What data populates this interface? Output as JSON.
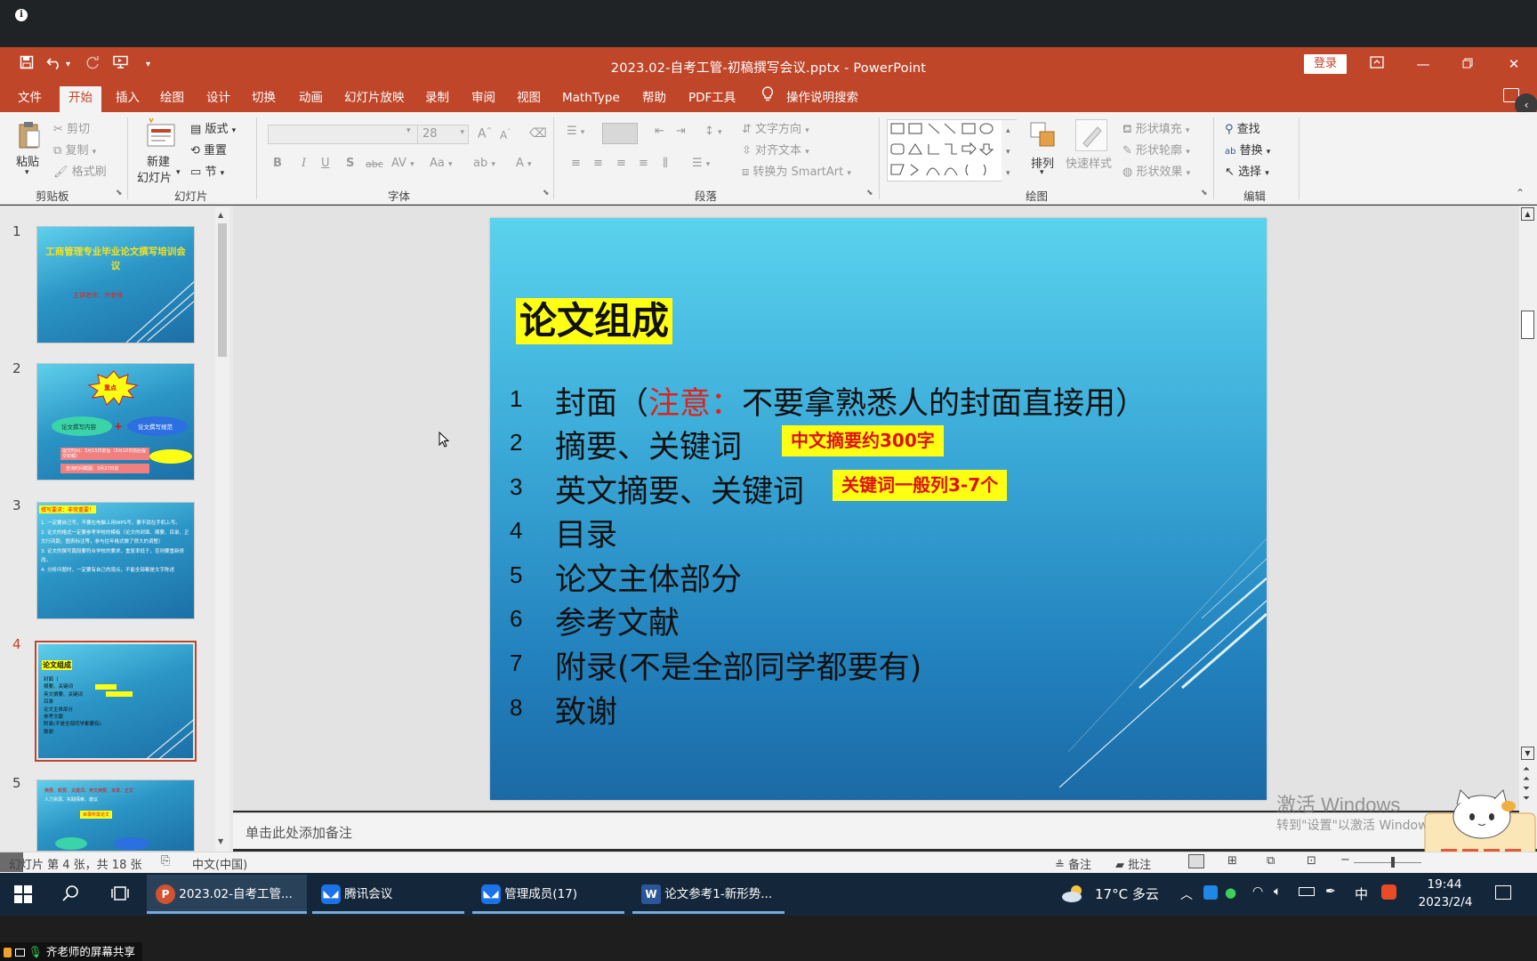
{
  "title_bar": {
    "document_title": "2023.02-自考工管-初稿撰写会议.pptx  -  PowerPoint",
    "login_label": "登录"
  },
  "ribbon_tabs": [
    {
      "label": "文件"
    },
    {
      "label": "开始",
      "active": true
    },
    {
      "label": "插入"
    },
    {
      "label": "绘图"
    },
    {
      "label": "设计"
    },
    {
      "label": "切换"
    },
    {
      "label": "动画"
    },
    {
      "label": "幻灯片放映"
    },
    {
      "label": "录制"
    },
    {
      "label": "审阅"
    },
    {
      "label": "视图"
    },
    {
      "label": "MathType"
    },
    {
      "label": "帮助"
    },
    {
      "label": "PDF工具"
    }
  ],
  "tell_me": "操作说明搜索",
  "ribbon": {
    "clipboard": {
      "paste": "粘贴",
      "cut": "剪切",
      "copy": "复制",
      "format_painter": "格式刷",
      "label": "剪贴板"
    },
    "slides": {
      "new_slide_1": "新建",
      "new_slide_2": "幻灯片",
      "layout": "版式",
      "reset": "重置",
      "section": "节",
      "label": "幻灯片"
    },
    "font": {
      "size": "28",
      "label": "字体"
    },
    "paragraph": {
      "text_direction": "文字方向",
      "align_text": "对齐文本",
      "smartart": "转换为 SmartArt",
      "label": "段落"
    },
    "drawing": {
      "arrange": "排列",
      "quick_styles": "快速样式",
      "shape_fill": "形状填充",
      "shape_outline": "形状轮廓",
      "shape_effects": "形状效果",
      "label": "绘图"
    },
    "editing": {
      "find": "查找",
      "replace": "替换",
      "select": "选择",
      "label": "编辑"
    }
  },
  "thumbnails": [
    {
      "num": "1",
      "title": "工商管理专业毕业论文撰写培训会议",
      "sub": "主讲老师：齐老师"
    },
    {
      "num": "2",
      "burst": "重点",
      "left": "论文撰写内容",
      "right": "论文撰写规范",
      "line1": "提交时间：3月15日前后（3月10日前后提交初稿）",
      "line2": "查询时间截图：3月27日前"
    },
    {
      "num": "3",
      "heading": "撰写要求：非常重要！",
      "lines": [
        "1. 一定要自己写，不要在电脑上用WPS写，要不就在手机上写。",
        "2. 论文的格式一定要参考学校的模板（论文的封面、摘要、目录、正文行间距、图表标注等，参与往年格式做了很大的调整）",
        "3. 论文的撰写篇段要符合学校的要求，重复率低于，否则要重新修改。",
        "4. 分析问题时，一定要有自己的观点，不能全部都是文字陈述"
      ]
    },
    {
      "num": "4",
      "title": "论文组成",
      "selected": true
    },
    {
      "num": "5",
      "lines": [
        "摘要、概要、关键词、英文摘要、目录、正文",
        "人力资源、实践探索、建议"
      ],
      "box": "目录所需论文"
    }
  ],
  "slide": {
    "title": "论文组成",
    "items": [
      {
        "num": "1",
        "text": "封面（",
        "red": "注意：",
        "rest": "不要拿熟悉人的封面直接用）"
      },
      {
        "num": "2",
        "text": "摘要、关键词"
      },
      {
        "num": "3",
        "text": "英文摘要、关键词"
      },
      {
        "num": "4",
        "text": "目录"
      },
      {
        "num": "5",
        "text": "论文主体部分"
      },
      {
        "num": "6",
        "text": "参考文献"
      },
      {
        "num": "7",
        "text": "附录(不是全部同学都要有)"
      },
      {
        "num": "8",
        "text": "致谢"
      }
    ],
    "callout_1": "中文摘要约300字",
    "callout_2": "关键词一般列3-7个"
  },
  "notes_placeholder": "单击此处添加备注",
  "watermark": {
    "line1": "激活 Windows",
    "line2": "转到\"设置\"以激活 Windows"
  },
  "status": {
    "slide_info": "幻灯片 第 4 张，共 18 张",
    "language": "中文(中国)",
    "notes": "备注",
    "comments": "批注"
  },
  "taskbar": {
    "apps": [
      {
        "label": "2023.02-自考工管...",
        "icon": "powerpoint-icon"
      },
      {
        "label": "腾讯会议",
        "icon": "tencent-meeting-icon"
      },
      {
        "label": "管理成员(17)",
        "icon": "tencent-meeting-icon"
      },
      {
        "label": "论文参考1-新形势...",
        "icon": "word-icon"
      }
    ],
    "weather": "17°C 多云",
    "ime": "中",
    "time": "19:44",
    "date": "2023/2/4"
  },
  "share_label": "齐老师的屏幕共享",
  "colors": {
    "accent": "#c0462a",
    "highlight": "#ffff14",
    "taskbar": "#14273a"
  }
}
